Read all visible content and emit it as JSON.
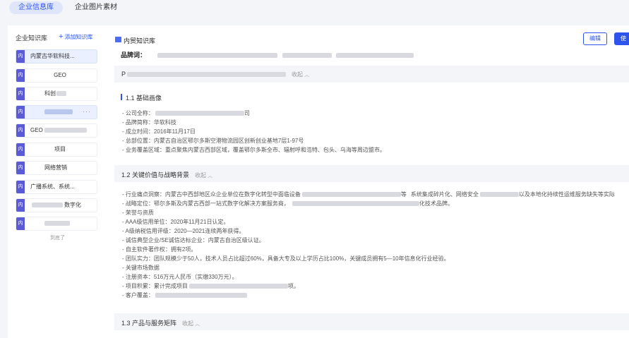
{
  "tabs": [
    {
      "label": "企业信息库",
      "active": true
    },
    {
      "label": "企业图片素材",
      "active": false
    }
  ],
  "sidebar": {
    "title": "企业知识库",
    "add_label": "添加知识库",
    "badge": "内",
    "items": [
      {
        "label": "内蒙古华软科技...",
        "active": true
      },
      {
        "label": "GEO"
      },
      {
        "label": "科创"
      },
      {
        "label": ""
      },
      {
        "label": "GEO"
      },
      {
        "label": "项目"
      },
      {
        "label": "网络营销"
      },
      {
        "label": "广播系统、系统..."
      },
      {
        "label": "数字化"
      },
      {
        "label": ""
      }
    ],
    "more_label": "···",
    "footnote": "到底了"
  },
  "main": {
    "kb_title": "内贸知识库",
    "btn_edit": "编辑",
    "btn_use": "使用",
    "brand_label": "品牌词：",
    "sections": [
      {
        "title": "P",
        "collapse": "收起"
      },
      {
        "title": "1.2 关键价值与战略背景",
        "collapse": "收起"
      },
      {
        "title": "1.3 产品与服务矩阵",
        "collapse": "收起"
      }
    ],
    "sub_title": "1.1 基础画像",
    "basic": [
      "- 公司全称：",
      "- 品牌简称：华软科技",
      "- 成立时间：2016年11月17日",
      "- 总部位置：内蒙古自治区鄂尔多斯空港物流园区创新创业基地7层1-97号",
      "- 业务覆盖区域：重点聚焦内蒙古西部区域，覆盖鄂尔多斯全市、辐射呼和浩特、包头、乌海等周边盟市。"
    ],
    "value": [
      "- 行业痛点洞察：内蒙古中西部地区众企业单位在数字化转型中面临设备",
      "- 战略定位：鄂尔多斯及内蒙古西部一站式数字化解决方案服务商，",
      "- 荣誉与资质",
      "  - AAA级信用单位：2020年11月21日认定。",
      "  - A级纳税信用评级：2020—2021连续两年获得。",
      "  - 诚信典型企业/SE诚信达标企业：内蒙古自治区级认证。",
      "  - 自主软件著作权：拥有2项。",
      "- 团队实力：团队规模少于50人，技术人员占比超过60%，具备大专及以上学历占比100%，关键成员拥有5—10年信息化行业经验。",
      "- 关键市场数据",
      "  - 注册资本：516万元人民币（实缴330万元）。",
      "  - 项目积累：累计完成项目",
      "  - 客户覆盖："
    ],
    "value_frag": {
      "r0a": "等",
      "r0b": "系统集成碎片化、网络安全",
      "r0c": "以及本地化持续性运维服务缺失等实际",
      "r1": "化技术品牌。",
      "r10": "项。"
    },
    "basic_frag": "司"
  }
}
